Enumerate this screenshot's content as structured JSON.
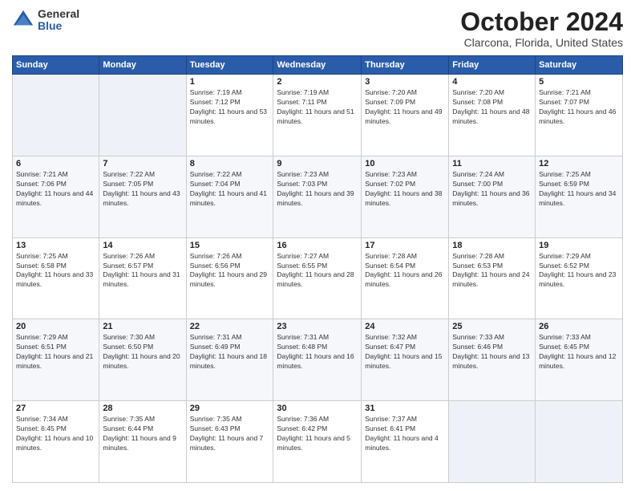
{
  "logo": {
    "general": "General",
    "blue": "Blue"
  },
  "header": {
    "title": "October 2024",
    "subtitle": "Clarcona, Florida, United States"
  },
  "weekdays": [
    "Sunday",
    "Monday",
    "Tuesday",
    "Wednesday",
    "Thursday",
    "Friday",
    "Saturday"
  ],
  "weeks": [
    [
      {
        "day": "",
        "info": ""
      },
      {
        "day": "",
        "info": ""
      },
      {
        "day": "1",
        "info": "Sunrise: 7:19 AM\nSunset: 7:12 PM\nDaylight: 11 hours and 53 minutes."
      },
      {
        "day": "2",
        "info": "Sunrise: 7:19 AM\nSunset: 7:11 PM\nDaylight: 11 hours and 51 minutes."
      },
      {
        "day": "3",
        "info": "Sunrise: 7:20 AM\nSunset: 7:09 PM\nDaylight: 11 hours and 49 minutes."
      },
      {
        "day": "4",
        "info": "Sunrise: 7:20 AM\nSunset: 7:08 PM\nDaylight: 11 hours and 48 minutes."
      },
      {
        "day": "5",
        "info": "Sunrise: 7:21 AM\nSunset: 7:07 PM\nDaylight: 11 hours and 46 minutes."
      }
    ],
    [
      {
        "day": "6",
        "info": "Sunrise: 7:21 AM\nSunset: 7:06 PM\nDaylight: 11 hours and 44 minutes."
      },
      {
        "day": "7",
        "info": "Sunrise: 7:22 AM\nSunset: 7:05 PM\nDaylight: 11 hours and 43 minutes."
      },
      {
        "day": "8",
        "info": "Sunrise: 7:22 AM\nSunset: 7:04 PM\nDaylight: 11 hours and 41 minutes."
      },
      {
        "day": "9",
        "info": "Sunrise: 7:23 AM\nSunset: 7:03 PM\nDaylight: 11 hours and 39 minutes."
      },
      {
        "day": "10",
        "info": "Sunrise: 7:23 AM\nSunset: 7:02 PM\nDaylight: 11 hours and 38 minutes."
      },
      {
        "day": "11",
        "info": "Sunrise: 7:24 AM\nSunset: 7:00 PM\nDaylight: 11 hours and 36 minutes."
      },
      {
        "day": "12",
        "info": "Sunrise: 7:25 AM\nSunset: 6:59 PM\nDaylight: 11 hours and 34 minutes."
      }
    ],
    [
      {
        "day": "13",
        "info": "Sunrise: 7:25 AM\nSunset: 6:58 PM\nDaylight: 11 hours and 33 minutes."
      },
      {
        "day": "14",
        "info": "Sunrise: 7:26 AM\nSunset: 6:57 PM\nDaylight: 11 hours and 31 minutes."
      },
      {
        "day": "15",
        "info": "Sunrise: 7:26 AM\nSunset: 6:56 PM\nDaylight: 11 hours and 29 minutes."
      },
      {
        "day": "16",
        "info": "Sunrise: 7:27 AM\nSunset: 6:55 PM\nDaylight: 11 hours and 28 minutes."
      },
      {
        "day": "17",
        "info": "Sunrise: 7:28 AM\nSunset: 6:54 PM\nDaylight: 11 hours and 26 minutes."
      },
      {
        "day": "18",
        "info": "Sunrise: 7:28 AM\nSunset: 6:53 PM\nDaylight: 11 hours and 24 minutes."
      },
      {
        "day": "19",
        "info": "Sunrise: 7:29 AM\nSunset: 6:52 PM\nDaylight: 11 hours and 23 minutes."
      }
    ],
    [
      {
        "day": "20",
        "info": "Sunrise: 7:29 AM\nSunset: 6:51 PM\nDaylight: 11 hours and 21 minutes."
      },
      {
        "day": "21",
        "info": "Sunrise: 7:30 AM\nSunset: 6:50 PM\nDaylight: 11 hours and 20 minutes."
      },
      {
        "day": "22",
        "info": "Sunrise: 7:31 AM\nSunset: 6:49 PM\nDaylight: 11 hours and 18 minutes."
      },
      {
        "day": "23",
        "info": "Sunrise: 7:31 AM\nSunset: 6:48 PM\nDaylight: 11 hours and 16 minutes."
      },
      {
        "day": "24",
        "info": "Sunrise: 7:32 AM\nSunset: 6:47 PM\nDaylight: 11 hours and 15 minutes."
      },
      {
        "day": "25",
        "info": "Sunrise: 7:33 AM\nSunset: 6:46 PM\nDaylight: 11 hours and 13 minutes."
      },
      {
        "day": "26",
        "info": "Sunrise: 7:33 AM\nSunset: 6:45 PM\nDaylight: 11 hours and 12 minutes."
      }
    ],
    [
      {
        "day": "27",
        "info": "Sunrise: 7:34 AM\nSunset: 6:45 PM\nDaylight: 11 hours and 10 minutes."
      },
      {
        "day": "28",
        "info": "Sunrise: 7:35 AM\nSunset: 6:44 PM\nDaylight: 11 hours and 9 minutes."
      },
      {
        "day": "29",
        "info": "Sunrise: 7:35 AM\nSunset: 6:43 PM\nDaylight: 11 hours and 7 minutes."
      },
      {
        "day": "30",
        "info": "Sunrise: 7:36 AM\nSunset: 6:42 PM\nDaylight: 11 hours and 5 minutes."
      },
      {
        "day": "31",
        "info": "Sunrise: 7:37 AM\nSunset: 6:41 PM\nDaylight: 11 hours and 4 minutes."
      },
      {
        "day": "",
        "info": ""
      },
      {
        "day": "",
        "info": ""
      }
    ]
  ]
}
